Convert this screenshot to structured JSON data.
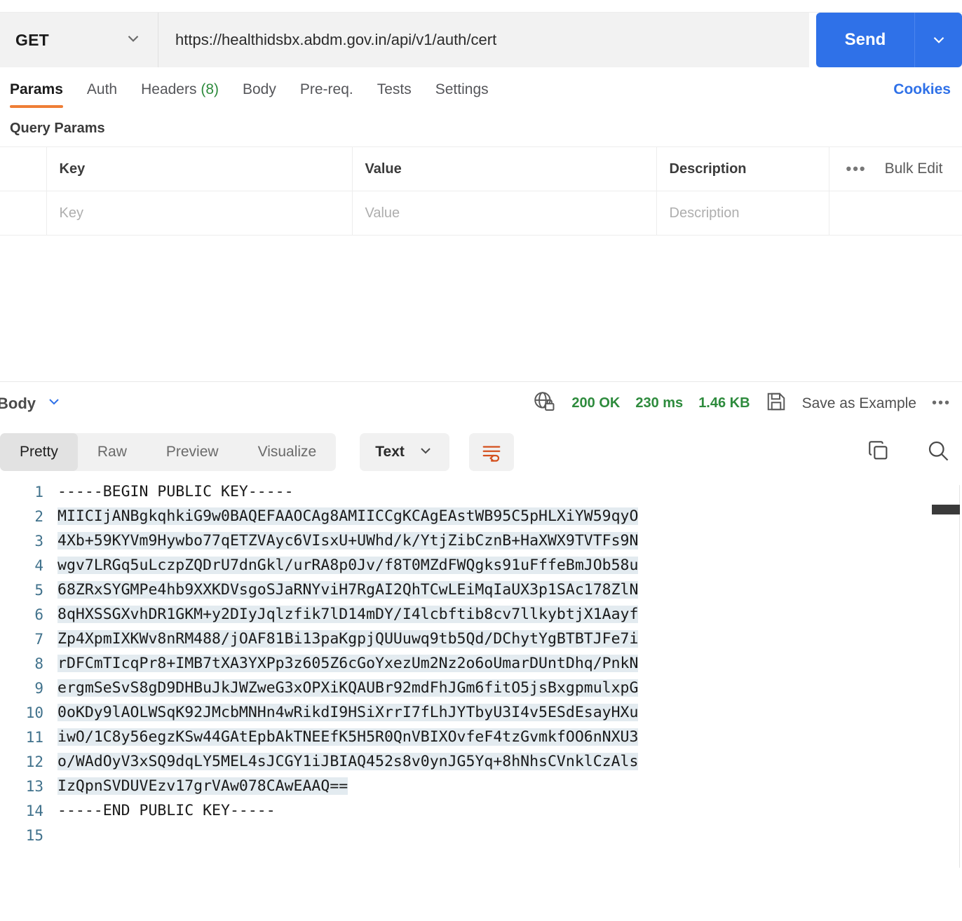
{
  "request": {
    "method": "GET",
    "url": "https://healthidsbx.abdm.gov.in/api/v1/auth/cert",
    "send_label": "Send",
    "tabs": [
      {
        "label": "Params",
        "active": true
      },
      {
        "label": "Auth",
        "active": false
      },
      {
        "label": "Headers",
        "badge": "(8)",
        "active": false
      },
      {
        "label": "Body",
        "active": false
      },
      {
        "label": "Pre-req.",
        "active": false
      },
      {
        "label": "Tests",
        "active": false
      },
      {
        "label": "Settings",
        "active": false
      }
    ],
    "cookies_label": "Cookies"
  },
  "query_params": {
    "title": "Query Params",
    "columns": [
      "Key",
      "Value",
      "Description"
    ],
    "bulk_edit_label": "Bulk Edit",
    "dots_label": "•••",
    "row_placeholders": [
      "Key",
      "Value",
      "Description"
    ]
  },
  "response": {
    "body_label": "Body",
    "status": "200 OK",
    "time": "230 ms",
    "size": "1.46 KB",
    "save_example_label": "Save as Example",
    "meta_dots": "•••",
    "view_tabs": [
      {
        "label": "Pretty",
        "active": true
      },
      {
        "label": "Raw",
        "active": false
      },
      {
        "label": "Preview",
        "active": false
      },
      {
        "label": "Visualize",
        "active": false
      }
    ],
    "format_select": "Text",
    "status_color": "#2e8b3d",
    "accent_color": "#ef7e36",
    "brand_color": "#2f71e8",
    "lines": [
      {
        "n": "1",
        "text": "-----BEGIN PUBLIC KEY-----",
        "selected": false
      },
      {
        "n": "2",
        "text": "MIICIjANBgkqhkiG9w0BAQEFAAOCAg8AMIICCgKCAgEAstWB95C5pHLXiYW59qyO",
        "selected": true
      },
      {
        "n": "3",
        "text": "4Xb+59KYVm9Hywbo77qETZVAyc6VIsxU+UWhd/k/YtjZibCznB+HaXWX9TVTFs9N",
        "selected": true
      },
      {
        "n": "4",
        "text": "wgv7LRGq5uLczpZQDrU7dnGkl/urRA8p0Jv/f8T0MZdFWQgks91uFffeBmJOb58u",
        "selected": true
      },
      {
        "n": "5",
        "text": "68ZRxSYGMPe4hb9XXKDVsgoSJaRNYviH7RgAI2QhTCwLEiMqIaUX3p1SAc178ZlN",
        "selected": true
      },
      {
        "n": "6",
        "text": "8qHXSSGXvhDR1GKM+y2DIyJqlzfik7lD14mDY/I4lcbftib8cv7llkybtjX1Aayf",
        "selected": true
      },
      {
        "n": "7",
        "text": "Zp4XpmIXKWv8nRM488/jOAF81Bi13paKgpjQUUuwq9tb5Qd/DChytYgBTBTJFe7i",
        "selected": true
      },
      {
        "n": "8",
        "text": "rDFCmTIcqPr8+IMB7tXA3YXPp3z605Z6cGoYxezUm2Nz2o6oUmarDUntDhq/PnkN",
        "selected": true
      },
      {
        "n": "9",
        "text": "ergmSeSvS8gD9DHBuJkJWZweG3xOPXiKQAUBr92mdFhJGm6fitO5jsBxgpmulxpG",
        "selected": true
      },
      {
        "n": "10",
        "text": "0oKDy9lAOLWSqK92JMcbMNHn4wRikdI9HSiXrrI7fLhJYTbyU3I4v5ESdEsayHXu",
        "selected": true
      },
      {
        "n": "11",
        "text": "iwO/1C8y56egzKSw44GAtEpbAkTNEEfK5H5R0QnVBIXOvfeF4tzGvmkfOO6nNXU3",
        "selected": true
      },
      {
        "n": "12",
        "text": "o/WAdOyV3xSQ9dqLY5MEL4sJCGY1iJBIAQ452s8v0ynJG5Yq+8hNhsCVnklCzAls",
        "selected": true
      },
      {
        "n": "13",
        "text": "IzQpnSVDUVEzv17grVAw078CAwEAAQ==",
        "selected": true
      },
      {
        "n": "14",
        "text": "-----END PUBLIC KEY-----",
        "selected": false
      },
      {
        "n": "15",
        "text": "",
        "selected": false
      }
    ]
  }
}
